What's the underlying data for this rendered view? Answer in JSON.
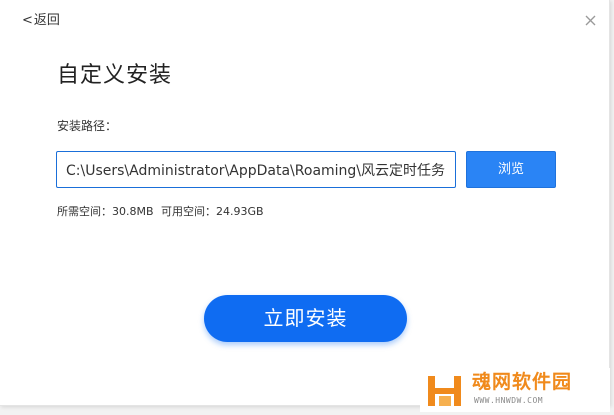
{
  "header": {
    "back_label": "返回",
    "back_icon": "chevron-left-icon",
    "close_icon": "close-icon"
  },
  "main": {
    "title": "自定义安装",
    "path_label": "安装路径：",
    "path_value": "C:\\Users\\Administrator\\AppData\\Roaming\\风云定时任务",
    "browse_label": "浏览",
    "space_required": "所需空间：30.8MB",
    "space_available": "可用空间：24.93GB",
    "install_label": "立即安装"
  },
  "watermark": {
    "name": "魂网软件园",
    "url": "WWW.HNWDW.COM"
  },
  "colors": {
    "accent": "#0f6cf2",
    "browse": "#2a84f5",
    "input_border": "#1a6fd9",
    "watermark": "#f08a1c"
  }
}
